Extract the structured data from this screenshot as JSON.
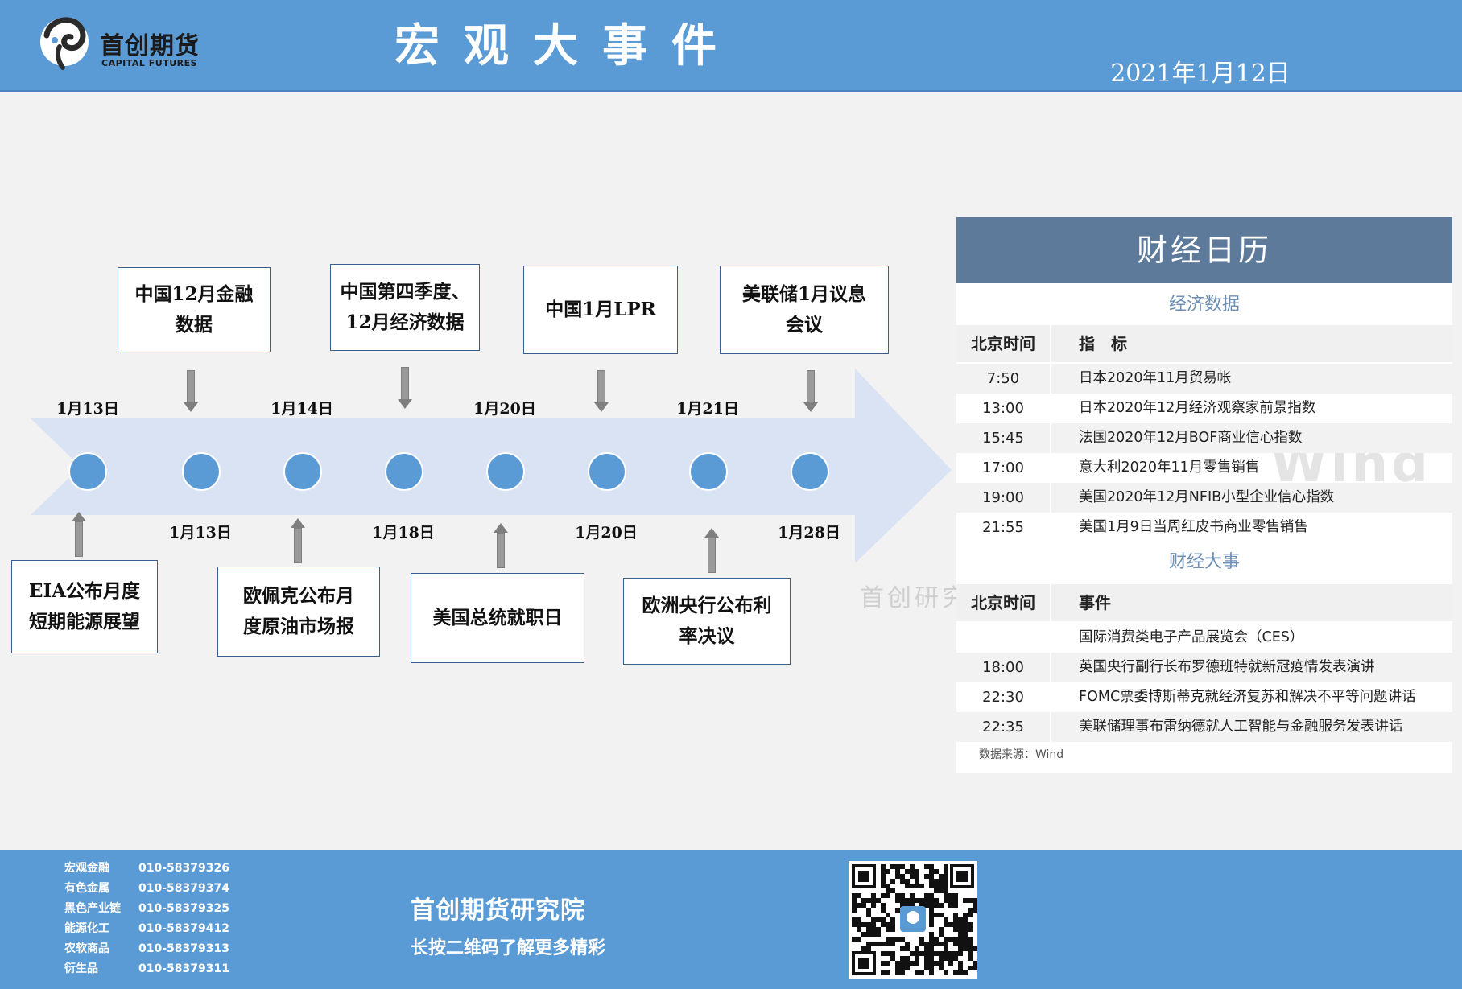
{
  "header": {
    "logo_cn": "首创期货",
    "logo_en": "CAPITAL FUTURES",
    "title": "宏观大事件",
    "date": "2021年1月12日"
  },
  "timeline": {
    "top_dates": [
      "1月13日",
      "1月14日",
      "1月20日",
      "1月21日"
    ],
    "bottom_dates": [
      "1月13日",
      "1月18日",
      "1月20日",
      "1月28日"
    ],
    "top_events": [
      {
        "lines": [
          "中国12月金融",
          "数据"
        ]
      },
      {
        "lines": [
          "中国第四季度、",
          "12月经济数据"
        ]
      },
      {
        "lines": [
          "中国1月LPR"
        ]
      },
      {
        "lines": [
          "美联储1月议息",
          "会议"
        ]
      }
    ],
    "bottom_events": [
      {
        "lines": [
          "EIA公布月度",
          "短期能源展望"
        ]
      },
      {
        "lines": [
          "欧佩克公布月",
          "度原油市场报"
        ]
      },
      {
        "lines": [
          "美国总统就职日"
        ]
      },
      {
        "lines": [
          "欧洲央行公布利",
          "率决议"
        ]
      }
    ],
    "watermark": "首创研究"
  },
  "calendar": {
    "title": "财经日历",
    "watermark": "Wind",
    "econ": {
      "section_title": "经济数据",
      "col_time": "北京时间",
      "col_item": "指　标",
      "rows": [
        {
          "time": "7:50",
          "item": "日本2020年11月贸易帐"
        },
        {
          "time": "13:00",
          "item": "日本2020年12月经济观察家前景指数"
        },
        {
          "time": "15:45",
          "item": "法国2020年12月BOF商业信心指数"
        },
        {
          "time": "17:00",
          "item": "意大利2020年11月零售销售"
        },
        {
          "time": "19:00",
          "item": "美国2020年12月NFIB小型企业信心指数"
        },
        {
          "time": "21:55",
          "item": "美国1月9日当周红皮书商业零售销售"
        }
      ]
    },
    "events": {
      "section_title": "财经大事",
      "col_time": "北京时间",
      "col_item": "事件",
      "rows": [
        {
          "time": "",
          "item": "国际消费类电子产品展览会（CES）"
        },
        {
          "time": "18:00",
          "item": "英国央行副行长布罗德班特就新冠疫情发表演讲"
        },
        {
          "time": "22:30",
          "item": "FOMC票委博斯蒂克就经济复苏和解决不平等问题讲话"
        },
        {
          "time": "22:35",
          "item": "美联储理事布雷纳德就人工智能与金融服务发表讲话"
        }
      ]
    },
    "source": "数据来源：Wind"
  },
  "footer": {
    "contacts": [
      {
        "dept": "宏观金融",
        "phone": "010-58379326"
      },
      {
        "dept": "有色金属",
        "phone": "010-58379374"
      },
      {
        "dept": "黑色产业链",
        "phone": "010-58379325"
      },
      {
        "dept": "能源化工",
        "phone": "010-58379412"
      },
      {
        "dept": "农软商品",
        "phone": "010-58379313"
      },
      {
        "dept": "衍生品",
        "phone": "010-58379311"
      }
    ],
    "org_name": "首创期货研究院",
    "slogan": "长按二维码了解更多精彩"
  },
  "colors": {
    "header_bg": "#5b9bd5",
    "arrow_fill": "#dae3f3",
    "dot_fill": "#5b9bd5",
    "calendar_title_bg": "#5d7a9a",
    "section_title_text": "#6d8fb3"
  }
}
